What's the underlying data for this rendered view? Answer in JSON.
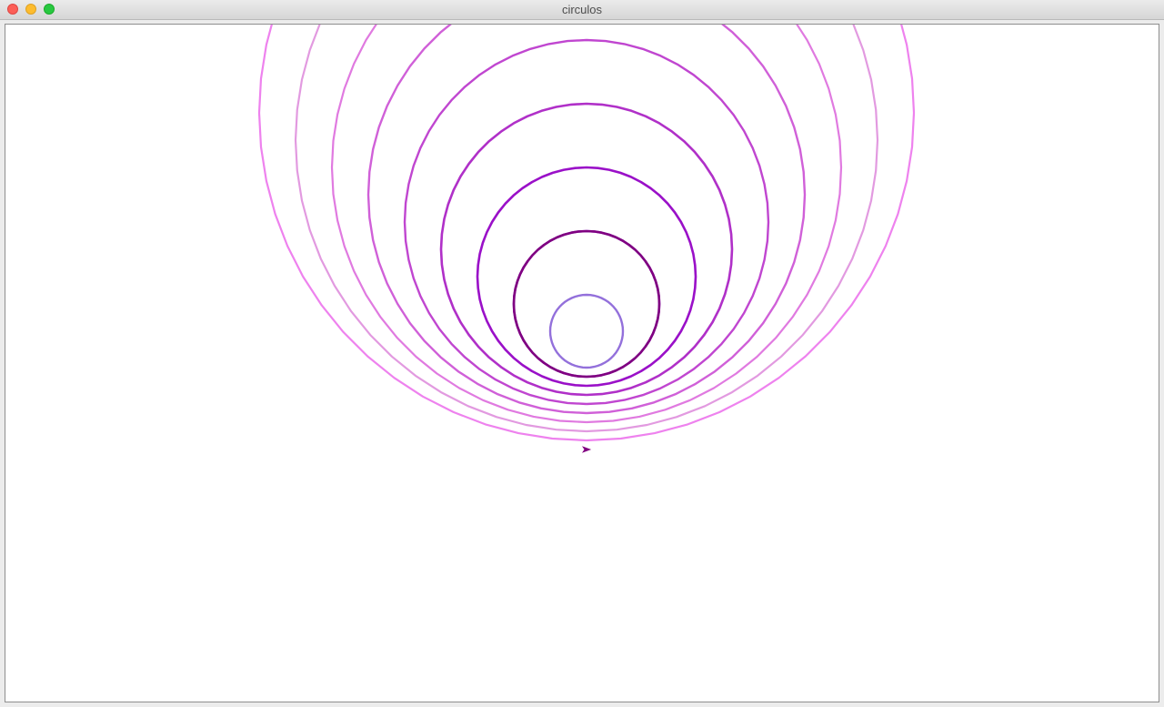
{
  "window": {
    "title": "circulos"
  },
  "drawing": {
    "background": "#ffffff",
    "turtle_color": "#800080",
    "circles": [
      {
        "color": "#ee82ee"
      },
      {
        "color": "#e29ae0"
      },
      {
        "color": "#e07ae0"
      },
      {
        "color": "#d060d8"
      },
      {
        "color": "#c046d0"
      },
      {
        "color": "#b030c8"
      },
      {
        "color": "#9a10c8"
      },
      {
        "color": "#9040e0"
      },
      {
        "color": "#800080"
      },
      {
        "color": "#9370db"
      }
    ]
  }
}
